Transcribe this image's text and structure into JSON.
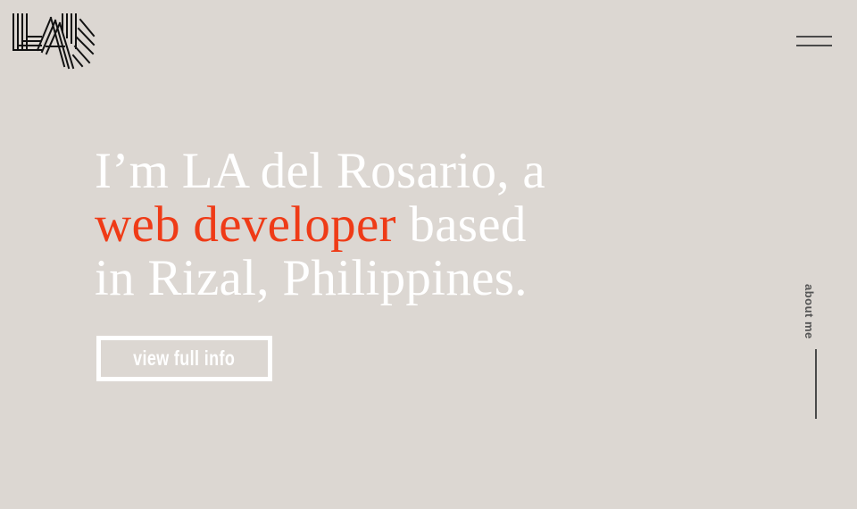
{
  "header": {
    "logo_icon": "LA-monogram-logo",
    "menu_icon": "hamburger-menu-icon"
  },
  "hero": {
    "line1": "I’m LA del Rosario, a",
    "highlight": "web developer",
    "line2_rest": " based",
    "line3": "in Rizal, Philippines.",
    "cta_label": "view full info"
  },
  "side_nav": {
    "label": "about me"
  },
  "colors": {
    "background": "#dcd7d2",
    "text": "#ffffff",
    "accent": "#ef3b17",
    "ink": "#4a4a4a"
  }
}
